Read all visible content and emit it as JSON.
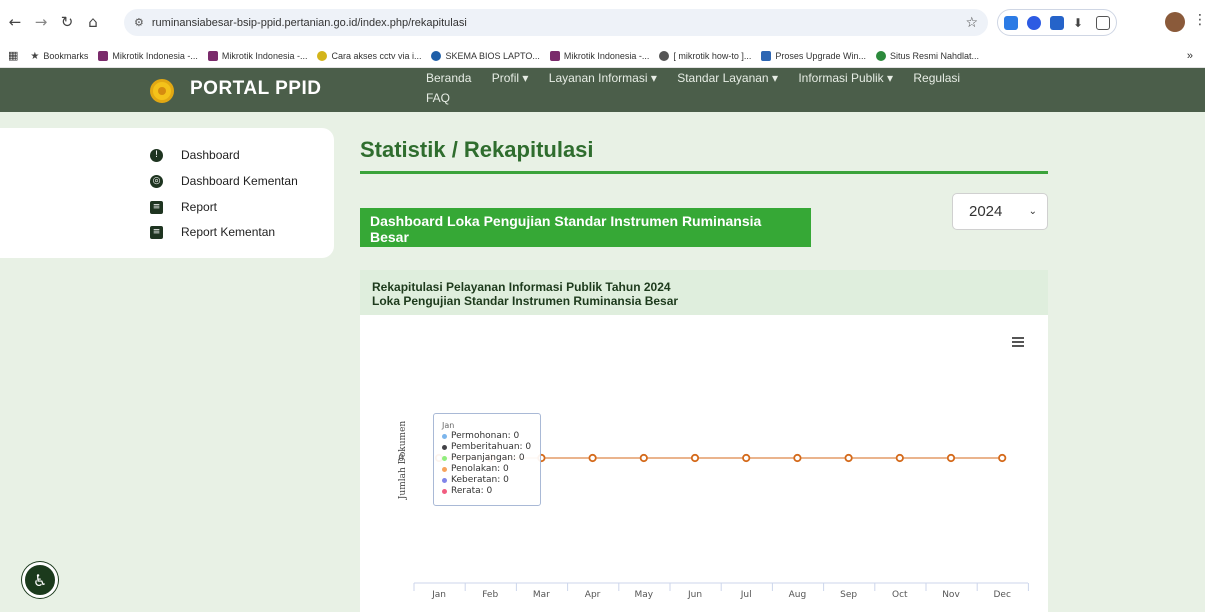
{
  "browser": {
    "url": "ruminansiabesar-bsip-ppid.pertanian.go.id/index.php/rekapitulasi",
    "nav_icons": [
      "back-icon",
      "forward-icon",
      "reload-icon",
      "home-icon"
    ],
    "bookmarks": [
      {
        "label": "Bookmarks",
        "color": "#444444"
      },
      {
        "label": "Mikrotik Indonesia -...",
        "color": "#7a2b6b"
      },
      {
        "label": "Mikrotik Indonesia -...",
        "color": "#7a2b6b"
      },
      {
        "label": "Cara akses cctv via i...",
        "color": "#d3b41a"
      },
      {
        "label": "SKEMA BIOS LAPTO...",
        "color": "#1f5fa8"
      },
      {
        "label": "Mikrotik Indonesia -...",
        "color": "#7a2b6b"
      },
      {
        "label": "[ mikrotik how-to ]...",
        "color": "#555555"
      },
      {
        "label": "Proses Upgrade Win...",
        "color": "#2d66b3"
      },
      {
        "label": "Situs Resmi Nahdlat...",
        "color": "#2c8a3c"
      }
    ],
    "overflow": "»"
  },
  "site": {
    "brand": "PORTAL PPID",
    "nav": {
      "items": [
        "Beranda",
        "Profil ▾",
        "Layanan Informasi ▾",
        "Standar Layanan ▾",
        "Informasi Publik ▾",
        "Regulasi"
      ],
      "faq": "FAQ"
    }
  },
  "sidebar": {
    "items": [
      {
        "label": "Dashboard",
        "icon": "info-icon"
      },
      {
        "label": "Dashboard Kementan",
        "icon": "globe-icon"
      },
      {
        "label": "Report",
        "icon": "book-icon"
      },
      {
        "label": "Report Kementan",
        "icon": "book-icon"
      }
    ]
  },
  "main": {
    "title": "Statistik / Rekapitulasi",
    "banner": "Dashboard Loka Pengujian Standar Instrumen Ruminansia Besar",
    "year": "2024",
    "chart_title_1": "Rekapitulasi Pelayanan Informasi Publik Tahun 2024",
    "chart_title_2": "Loka Pengujian Standar Instrumen Ruminansia Besar"
  },
  "tooltip": {
    "header": "Jan",
    "rows": [
      {
        "label": "Permohonan: 0",
        "color": "#7cb5ec"
      },
      {
        "label": "Pemberitahuan: 0",
        "color": "#434348"
      },
      {
        "label": "Perpanjangan: 0",
        "color": "#90ed7d"
      },
      {
        "label": "Penolakan: 0",
        "color": "#f7a35c"
      },
      {
        "label": "Keberatan: 0",
        "color": "#8085e9"
      },
      {
        "label": "Rerata: 0",
        "color": "#f15c80"
      }
    ]
  },
  "chart_data": {
    "type": "line",
    "categories": [
      "Jan",
      "Feb",
      "Mar",
      "Apr",
      "May",
      "Jun",
      "Jul",
      "Aug",
      "Sep",
      "Oct",
      "Nov",
      "Dec"
    ],
    "ylabel": "Jumlah Dokumen",
    "yticks": [
      "0"
    ],
    "series": [
      {
        "name": "Permohonan",
        "color": "#7cb5ec",
        "values": [
          0,
          0,
          0,
          0,
          0,
          0,
          0,
          0,
          0,
          0,
          0,
          0
        ]
      },
      {
        "name": "Pemberitahuan",
        "color": "#434348",
        "values": [
          0,
          0,
          0,
          0,
          0,
          0,
          0,
          0,
          0,
          0,
          0,
          0
        ]
      },
      {
        "name": "Perpanjangan",
        "color": "#90ed7d",
        "values": [
          0,
          0,
          0,
          0,
          0,
          0,
          0,
          0,
          0,
          0,
          0,
          0
        ]
      },
      {
        "name": "Penolakan",
        "color": "#f7a35c",
        "values": [
          0,
          0,
          0,
          0,
          0,
          0,
          0,
          0,
          0,
          0,
          0,
          0
        ]
      },
      {
        "name": "Keberatan",
        "color": "#8085e9",
        "values": [
          0,
          0,
          0,
          0,
          0,
          0,
          0,
          0,
          0,
          0,
          0,
          0
        ]
      },
      {
        "name": "Rerata",
        "color": "#d46a1b",
        "values": [
          0,
          0,
          0,
          0,
          0,
          0,
          0,
          0,
          0,
          0,
          0,
          0
        ]
      }
    ]
  }
}
